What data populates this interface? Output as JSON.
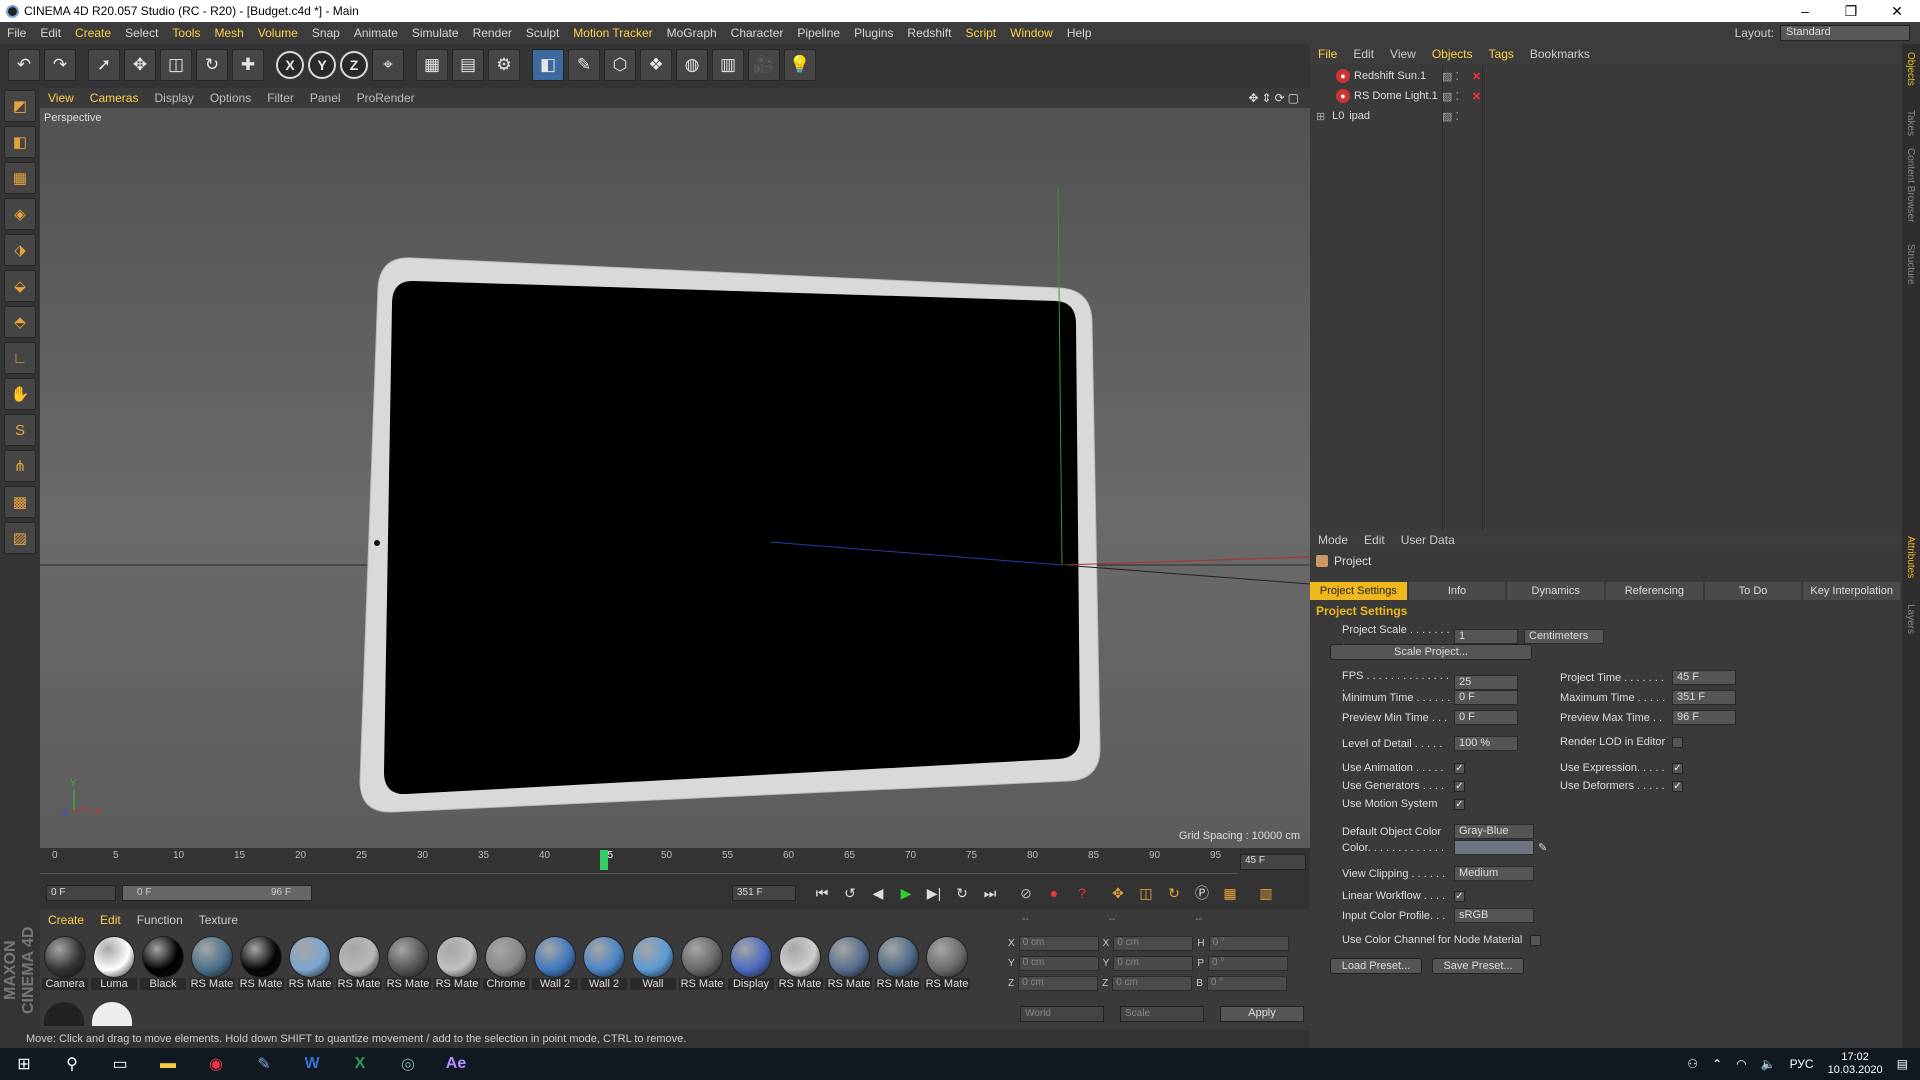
{
  "window": {
    "title": "CINEMA 4D R20.057 Studio (RC - R20) - [Budget.c4d *] - Main",
    "controls": [
      "–",
      "❐",
      "✕"
    ]
  },
  "menu": [
    "File",
    "Edit",
    "Create",
    "Select",
    "Tools",
    "Mesh",
    "Volume",
    "Snap",
    "Animate",
    "Simulate",
    "Render",
    "Sculpt",
    "Motion Tracker",
    "MoGraph",
    "Character",
    "Pipeline",
    "Plugins",
    "Redshift",
    "Script",
    "Window",
    "Help"
  ],
  "layout": {
    "label": "Layout:",
    "value": "Standard"
  },
  "viewport": {
    "menu": [
      "View",
      "Cameras",
      "Display",
      "Options",
      "Filter",
      "Panel",
      "ProRender"
    ],
    "camera_label": "Perspective",
    "grid_spacing": "Grid Spacing : 10000 cm"
  },
  "timeline": {
    "ticks": [
      "0",
      "5",
      "10",
      "15",
      "20",
      "25",
      "30",
      "35",
      "40",
      "45",
      "50",
      "55",
      "60",
      "65",
      "70",
      "75",
      "80",
      "85",
      "90",
      "95"
    ],
    "current_frame": "45 F",
    "start_field": "0 F",
    "range_start": "0 F",
    "range_end": "96 F",
    "end_field": "351 F"
  },
  "materials": {
    "menu": [
      "Create",
      "Edit",
      "Function",
      "Texture"
    ],
    "items": [
      {
        "name": "Camera",
        "color": "#333"
      },
      {
        "name": "Luma",
        "color": "#fff"
      },
      {
        "name": "Black",
        "color": "#000"
      },
      {
        "name": "RS Mate",
        "color": "#4a6f8a"
      },
      {
        "name": "RS Mate",
        "color": "#050505"
      },
      {
        "name": "RS Mate",
        "color": "#7aa6cf"
      },
      {
        "name": "RS Mate",
        "color": "#b8b8b8"
      },
      {
        "name": "RS Mate",
        "color": "#555"
      },
      {
        "name": "RS Mate",
        "color": "#c0c0c0"
      },
      {
        "name": "Chrome",
        "color": "#888"
      },
      {
        "name": "Wall 2",
        "color": "#3f78bf"
      },
      {
        "name": "Wall 2",
        "color": "#4a84c7"
      },
      {
        "name": "Wall",
        "color": "#5b9ad4"
      },
      {
        "name": "RS Mate",
        "color": "#666"
      },
      {
        "name": "Display",
        "color": "#4a6ac0"
      },
      {
        "name": "RS Mate",
        "color": "#cfcfcf"
      },
      {
        "name": "RS Mate",
        "color": "#556e8e"
      },
      {
        "name": "RS Mate",
        "color": "#4d6a86"
      },
      {
        "name": "RS Mate",
        "color": "#6b6b6b"
      }
    ]
  },
  "coords": {
    "rows": [
      {
        "a": "X",
        "av": "0 cm",
        "b": "X",
        "bv": "0 cm",
        "c": "H",
        "cv": "0 °"
      },
      {
        "a": "Y",
        "av": "0 cm",
        "b": "Y",
        "bv": "0 cm",
        "c": "P",
        "cv": "0 °"
      },
      {
        "a": "Z",
        "av": "0 cm",
        "b": "Z",
        "bv": "0 cm",
        "c": "B",
        "cv": "0 °"
      }
    ],
    "headers": [
      "--",
      "--",
      "--"
    ],
    "world": "World",
    "scale": "Scale",
    "apply": "Apply"
  },
  "status": "Move: Click and drag to move elements. Hold down SHIFT to quantize movement / add to the selection in point mode, CTRL to remove.",
  "objects": {
    "menu": [
      "File",
      "Edit",
      "View",
      "Objects",
      "Tags",
      "Bookmarks"
    ],
    "items": [
      "Redshift Sun.1",
      "RS Dome Light.1",
      "ipad"
    ]
  },
  "attributes": {
    "menu": [
      "Mode",
      "Edit",
      "User Data"
    ],
    "title": "Project",
    "tabs": [
      "Project Settings",
      "Info",
      "Dynamics",
      "Referencing",
      "To Do",
      "Key Interpolation"
    ],
    "section": "Project Settings",
    "project_scale_label": "Project Scale . . . . . . . .",
    "project_scale": "1",
    "project_scale_unit": "Centimeters",
    "scale_project_btn": "Scale Project...",
    "fps_label": "FPS . . . . . . . . . . . . . . .",
    "fps": "25",
    "project_time_label": "Project Time . . . . . . .",
    "project_time": "45 F",
    "min_time_label": "Minimum Time . . . . . .",
    "min_time": "0 F",
    "max_time_label": "Maximum Time . . . . .",
    "max_time": "351 F",
    "prev_min_label": "Preview Min Time . . .",
    "prev_min": "0 F",
    "prev_max_label": "Preview Max Time . .",
    "prev_max": "96 F",
    "lod_label": "Level of Detail . . . . .",
    "lod": "100 %",
    "render_lod_label": "Render LOD in Editor",
    "use_anim": "Use Animation . . . . .",
    "use_expr": "Use Expression. . . . .",
    "use_gen": "Use Generators . . . .",
    "use_def": "Use Deformers . . . . .",
    "use_motion": "Use Motion System",
    "def_color_label": "Default Object Color",
    "def_color": "Gray-Blue",
    "color_label": "Color. . . . . . . . . . . . .",
    "view_clip_label": "View Clipping . . . . . .",
    "view_clip": "Medium",
    "linear_label": "Linear Workflow . . . .",
    "input_profile_label": "Input Color Profile. . .",
    "input_profile": "sRGB",
    "color_channel_label": "Use Color Channel for Node Material",
    "load_preset": "Load Preset...",
    "save_preset": "Save Preset..."
  },
  "right_strip": [
    "Objects",
    "Takes",
    "Content Browser",
    "Structure",
    "Attributes",
    "Layers"
  ],
  "taskbar": {
    "lang": "РУС",
    "time": "17:02",
    "date": "10.03.2020"
  }
}
